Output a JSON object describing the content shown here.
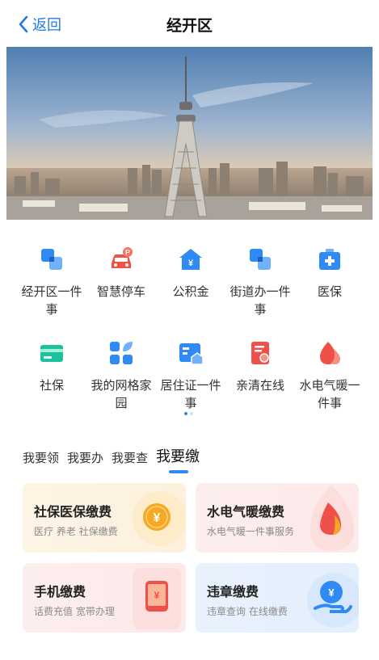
{
  "header": {
    "back_label": "返回",
    "title": "经开区"
  },
  "grid": {
    "items": [
      {
        "label": "经开区一件事",
        "icon": "squares-icon",
        "color": "#2f8af5"
      },
      {
        "label": "智慧停车",
        "icon": "car-parking-icon",
        "color": "#f0504a"
      },
      {
        "label": "公积金",
        "icon": "house-yuan-icon",
        "color": "#2f8af5"
      },
      {
        "label": "街道办一件事",
        "icon": "squares-icon",
        "color": "#2f8af5"
      },
      {
        "label": "医保",
        "icon": "medical-kit-icon",
        "color": "#2f8af5"
      },
      {
        "label": "社保",
        "icon": "card-icon",
        "color": "#1cc29e"
      },
      {
        "label": "我的网格家园",
        "icon": "grid-leaf-icon",
        "color": "#2f8af5"
      },
      {
        "label": "居住证一件事",
        "icon": "residence-card-icon",
        "color": "#2f8af5"
      },
      {
        "label": "亲清在线",
        "icon": "certificate-icon",
        "color": "#f0504a"
      },
      {
        "label": "水电气暖一件事",
        "icon": "drop-flame-icon",
        "color": "#f0504a"
      }
    ]
  },
  "tabs": [
    {
      "label": "我要领"
    },
    {
      "label": "我要办"
    },
    {
      "label": "我要查"
    },
    {
      "label": "我要缴",
      "active": true
    }
  ],
  "cards": [
    {
      "title": "社保医保缴费",
      "subtitle": "医疗 养老 社保缴费",
      "icon": "yuan-coin-icon"
    },
    {
      "title": "水电气暖缴费",
      "subtitle": "水电气暖一件事服务",
      "icon": "flame-icon"
    },
    {
      "title": "手机缴费",
      "subtitle": "话费充值 宽带办理",
      "icon": "phone-icon"
    },
    {
      "title": "违章缴费",
      "subtitle": "违章查询 在线缴费",
      "icon": "hand-coin-icon"
    }
  ],
  "colors": {
    "accent": "#2f8af5",
    "back": "#1f7ae8",
    "red": "#f0504a",
    "green": "#1cc29e",
    "orange": "#f7a823"
  }
}
